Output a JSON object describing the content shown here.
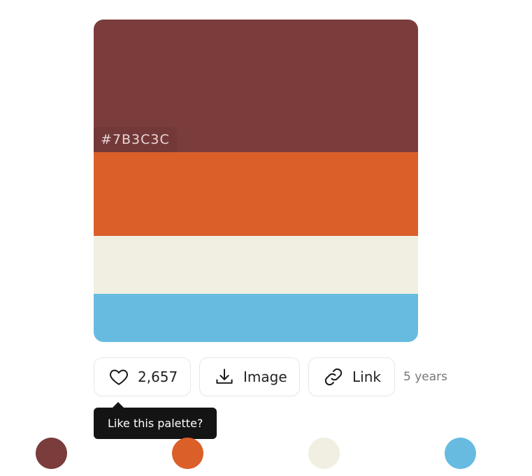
{
  "palette": {
    "colors": [
      "#7B3C3C",
      "#DB5F29",
      "#F0EFE2",
      "#67BBE1"
    ],
    "hovered_hex": "#7B3C3C"
  },
  "actions": {
    "likes": "2,657",
    "image_label": "Image",
    "link_label": "Link",
    "age": "5 years"
  },
  "tooltip": {
    "text": "Like this palette?"
  },
  "icons": {
    "like": "heart-icon",
    "image": "download-icon",
    "link": "link-icon"
  }
}
